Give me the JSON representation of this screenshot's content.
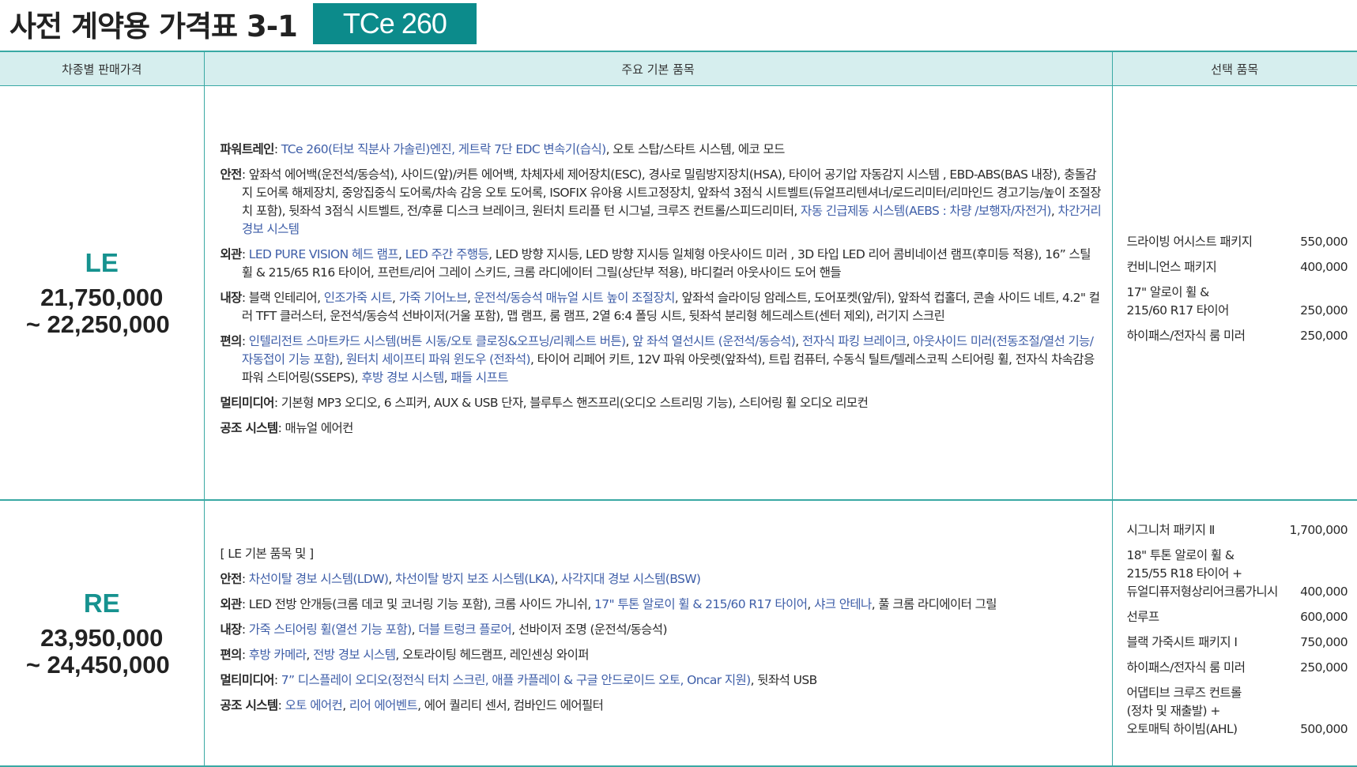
{
  "title": "사전 계약용 가격표 3-1",
  "badge": "TCe 260",
  "headers": [
    "차종별 판매가격",
    "주요 기본 품목",
    "선택 품목"
  ],
  "le": {
    "name": "LE",
    "price_line1": "21,750,000",
    "price_line2": "~ 22,250,000",
    "features": [
      {
        "label": "파워트레인",
        "segments": [
          {
            "t": " : ",
            "b": false
          },
          {
            "t": "TCe 260(터보 직분사 가솔린)엔진, 게트락 7단  EDC 변속기(습식)",
            "b": true
          },
          {
            "t": ", 오토 스탑/스타트 시스템, 에코 모드",
            "b": false
          }
        ]
      },
      {
        "label": "안전",
        "segments": [
          {
            "t": " : 앞좌석 에어백(운전석/동승석), 사이드(앞)/커튼 에어백, 차체자세 제어장치(ESC), 경사로 밀림방지장치(HSA), 타이어 공기압 자동감지 시스템 , EBD-ABS(BAS 내장), 충돌감지 도어록 해제장치, 중앙집중식 도어록/차속 감응 오토 도어록, ISOFIX 유아용 시트고정장치, 앞좌석 3점식 시트벨트(듀얼프리텐셔너/로드리미터/리마인드 경고기능/높이 조절장치 포함), 뒷좌석 3점식 시트벨트, 전/후륜 디스크 브레이크, 원터치 트리플 턴 시그널, 크루즈 컨트롤/스피드리미터, ",
            "b": false
          },
          {
            "t": "자동 긴급제동 시스템(AEBS : 차량 /보행자/자전거)",
            "b": true
          },
          {
            "t": ", ",
            "b": false
          },
          {
            "t": "차간거리 경보 시스템",
            "b": true
          }
        ]
      },
      {
        "label": "외관",
        "segments": [
          {
            "t": " : ",
            "b": false
          },
          {
            "t": "LED PURE VISION 헤드 램프",
            "b": true
          },
          {
            "t": ", ",
            "b": false
          },
          {
            "t": "LED 주간 주행등",
            "b": true
          },
          {
            "t": ", LED 방향 지시등, LED 방향 지시등 일체형 아웃사이드 미러 , 3D 타입  LED 리어 콤비네이션 램프(후미등 적용), 16” 스틸 휠  & 215/65 R16 타이어, 프런트/리어 그레이 스키드, 크롬 라디에이터 그릴(상단부 적용), 바디컬러 아웃사이드 도어 핸들",
            "b": false
          }
        ]
      },
      {
        "label": "내장",
        "segments": [
          {
            "t": " : 블랙 인테리어, ",
            "b": false
          },
          {
            "t": "인조가죽 시트",
            "b": true
          },
          {
            "t": ", ",
            "b": false
          },
          {
            "t": "가죽 기어노브",
            "b": true
          },
          {
            "t": ", ",
            "b": false
          },
          {
            "t": "운전석/동승석 매뉴얼 시트 높이 조절장치",
            "b": true
          },
          {
            "t": ", 앞좌석 슬라이딩 암레스트, 도어포켓(앞/뒤), 앞좌석 컵홀더, 콘솔 사이드 네트, 4.2\" 컬러 TFT 클러스터, 운전석/동승석 선바이저(거울 포함), 맵 램프, 룸 램프, 2열 6:4 폴딩 시트, 뒷좌석 분리형 헤드레스트(센터 제외), 러기지 스크린",
            "b": false
          }
        ]
      },
      {
        "label": "편의",
        "segments": [
          {
            "t": " : ",
            "b": false
          },
          {
            "t": "인텔리전트 스마트카드 시스템(버튼 시동/오토 클로징&오프닝/리퀘스트 버튼)",
            "b": true
          },
          {
            "t": ", ",
            "b": false
          },
          {
            "t": "앞 좌석 열선시트 (운전석/동승석)",
            "b": true
          },
          {
            "t": ", ",
            "b": false
          },
          {
            "t": "전자식 파킹 브레이크",
            "b": true
          },
          {
            "t": ", ",
            "b": false
          },
          {
            "t": "아웃사이드 미러(전동조절/열선 기능/자동접이 기능 포함)",
            "b": true
          },
          {
            "t": ", ",
            "b": false
          },
          {
            "t": "원터치 세이프티 파워 윈도우 (전좌석)",
            "b": true
          },
          {
            "t": ", 타이어 리페어 키트, 12V 파워 아웃렛(앞좌석), 트립 컴퓨터, 수동식 틸트/텔레스코픽 스티어링 휠, 전자식 차속감응 파워 스티어링(SSEPS), ",
            "b": false
          },
          {
            "t": "후방 경보 시스템",
            "b": true
          },
          {
            "t": ", ",
            "b": false
          },
          {
            "t": "패들 시프트",
            "b": true
          }
        ]
      },
      {
        "label": "멀티미디어",
        "segments": [
          {
            "t": " : 기본형 MP3 오디오, 6 스피커, AUX & USB 단자, 블루투스 핸즈프리(오디오 스트리밍 기능), 스티어링 휠 오디오 리모컨",
            "b": false
          }
        ]
      },
      {
        "label": "공조 시스템",
        "segments": [
          {
            "t": " : 매뉴얼 에어컨",
            "b": false
          }
        ]
      }
    ],
    "options": [
      {
        "name": "드라이빙 어시스트 패키지",
        "price": "550,000"
      },
      {
        "name": "컨비니언스 패키지",
        "price": "400,000"
      },
      {
        "name": "17\" 알로이 휠 &\n215/60 R17 타이어",
        "price": "250,000"
      },
      {
        "name": "하이패스/전자식 룸 미러",
        "price": "250,000"
      }
    ]
  },
  "re": {
    "name": "RE",
    "price_line1": "23,950,000",
    "price_line2": "~ 24,450,000",
    "note": "[ LE 기본 품목 및 ]",
    "features": [
      {
        "label": "안전",
        "segments": [
          {
            "t": " : ",
            "b": false
          },
          {
            "t": "차선이탈 경보 시스템(LDW)",
            "b": true
          },
          {
            "t": ", ",
            "b": false
          },
          {
            "t": "차선이탈 방지 보조 시스템(LKA)",
            "b": true
          },
          {
            "t": ", ",
            "b": false
          },
          {
            "t": "사각지대 경보 시스템(BSW)",
            "b": true
          }
        ]
      },
      {
        "label": "외관",
        "segments": [
          {
            "t": " : LED 전방 안개등(크롬 데코 및 코너링 기능 포함), 크롬 사이드 가니쉬, ",
            "b": false
          },
          {
            "t": "17\"  투톤 알로이 휠 & 215/60 R17 타이어",
            "b": true
          },
          {
            "t": ", ",
            "b": false
          },
          {
            "t": "샤크 안테나",
            "b": true
          },
          {
            "t": ", 풀 크롬 라디에이터 그릴",
            "b": false
          }
        ]
      },
      {
        "label": "내장",
        "segments": [
          {
            "t": " : ",
            "b": false
          },
          {
            "t": "가죽 스티어링 휠(열선 기능 포함)",
            "b": true
          },
          {
            "t": ", ",
            "b": false
          },
          {
            "t": "더블 트렁크 플로어",
            "b": true
          },
          {
            "t": ", 선바이저 조명 (운전석/동승석)",
            "b": false
          }
        ]
      },
      {
        "label": "편의",
        "segments": [
          {
            "t": " : ",
            "b": false
          },
          {
            "t": "후방 카메라",
            "b": true
          },
          {
            "t": ", ",
            "b": false
          },
          {
            "t": "전방 경보 시스템",
            "b": true
          },
          {
            "t": ", 오토라이팅 헤드램프, 레인센싱 와이퍼",
            "b": false
          }
        ]
      },
      {
        "label": "멀티미디어",
        "segments": [
          {
            "t": " : ",
            "b": false
          },
          {
            "t": "7” 디스플레이 오디오(정전식 터치 스크린, 애플 카플레이 & 구글 안드로이드 오토, Oncar 지원)",
            "b": true
          },
          {
            "t": ", 뒷좌석 USB",
            "b": false
          }
        ]
      },
      {
        "label": "공조 시스템",
        "segments": [
          {
            "t": " : ",
            "b": false
          },
          {
            "t": "오토 에어컨",
            "b": true
          },
          {
            "t": ", ",
            "b": false
          },
          {
            "t": "리어 에어벤트",
            "b": true
          },
          {
            "t": ", 에어 퀄리티 센서, 컴바인드 에어필터",
            "b": false
          }
        ]
      }
    ],
    "options": [
      {
        "name": "시그니처 패키지 Ⅱ",
        "price": "1,700,000"
      },
      {
        "name": "18\" 투톤 알로이 휠 &\n215/55 R18 타이어 +\n듀얼디퓨저형상리어크롬가니시",
        "price": "400,000"
      },
      {
        "name": "선루프",
        "price": "600,000"
      },
      {
        "name": "블랙 가죽시트 패키지 Ⅰ",
        "price": "750,000"
      },
      {
        "name": "하이패스/전자식 룸 미러",
        "price": "250,000"
      },
      {
        "name": "어댑티브 크루즈 컨트롤\n(정차 및 재출발) +\n오토매틱 하이빔(AHL)",
        "price": "500,000"
      }
    ]
  }
}
